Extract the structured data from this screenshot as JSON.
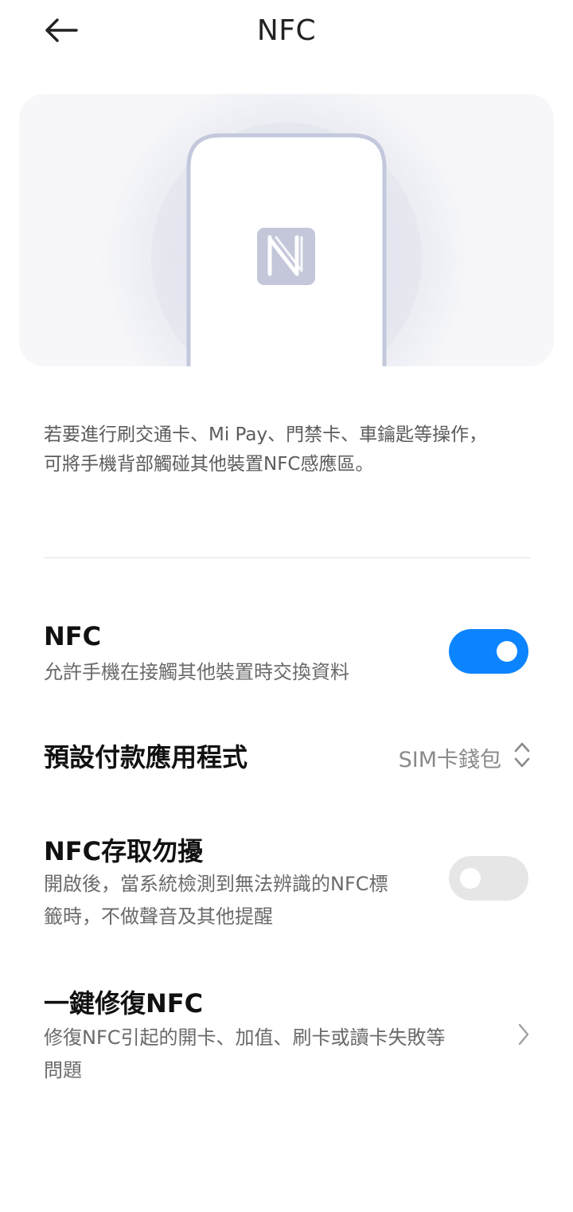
{
  "header": {
    "title": "NFC",
    "back_icon": "arrow-left-icon"
  },
  "illustration": {
    "phone_icon": "phone-outline-icon",
    "nfc_icon": "nfc-n-icon"
  },
  "description": {
    "line1": "若要進行刷交通卡、Mi Pay、門禁卡、車鑰匙等操作，",
    "line2": "可將手機背部觸碰其他裝置NFC感應區。"
  },
  "settings": {
    "nfc": {
      "title": "NFC",
      "subtitle": "允許手機在接觸其他裝置時交換資料",
      "enabled": true
    },
    "default_payment": {
      "title": "預設付款應用程式",
      "value": "SIM卡錢包",
      "icon": "up-down-chevron-icon"
    },
    "nfc_dnd": {
      "title": "NFC存取勿擾",
      "subtitle_line1": "開啟後，當系統檢測到無法辨識的NFC標",
      "subtitle_line2": "籤時，不做聲音及其他提醒",
      "enabled": false
    },
    "nfc_repair": {
      "title": "一鍵修復NFC",
      "subtitle_line1": "修復NFC引起的開卡、加值、刷卡或讀卡失敗等",
      "subtitle_line2": "問題",
      "icon": "chevron-right-icon"
    }
  },
  "colors": {
    "accent": "#0d84ff",
    "toggle_off": "#e6e6e6",
    "illustration_bg": "#f7f7fa",
    "phone_outline": "#c4c8dc"
  }
}
